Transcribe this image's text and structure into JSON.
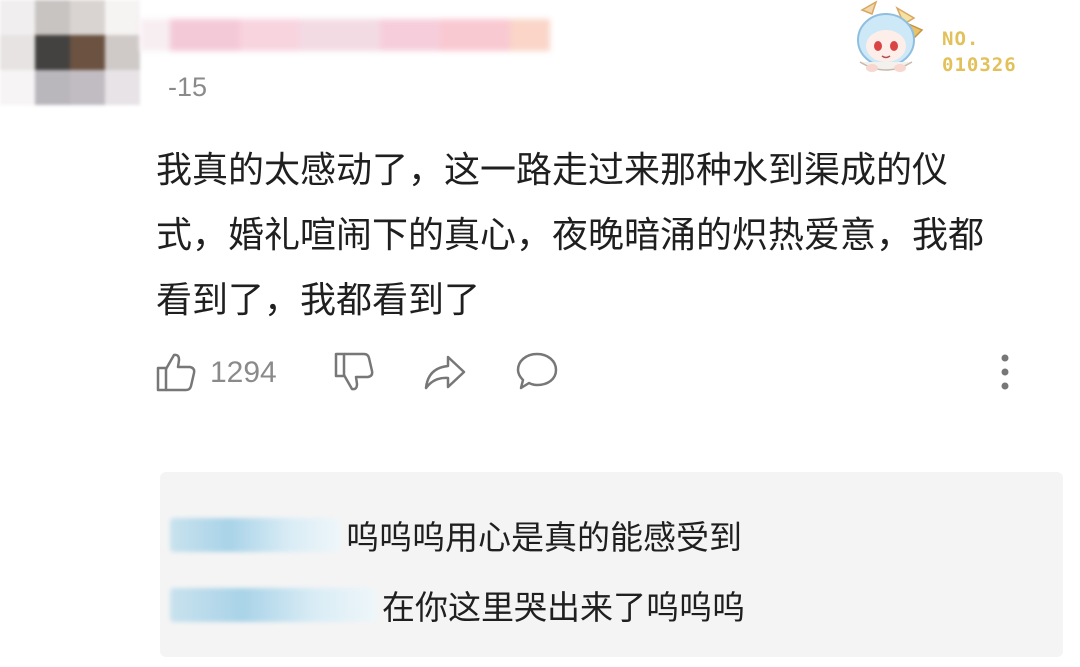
{
  "comment": {
    "date_fragment": "-15",
    "lines": [
      "我真的太感动了，这一路走过来那种水到渠成的仪",
      "式，婚礼喧闹下的真心，夜晚暗涌的炽热爱意，我都",
      "看到了，我都看到了"
    ],
    "like_count": "1294"
  },
  "badge": {
    "label_line1": "NO.",
    "label_line2": "010326"
  },
  "replies": [
    {
      "text": "呜呜呜用心是真的能感受到"
    },
    {
      "text": "在你这里哭出来了呜呜呜"
    }
  ],
  "icons": [
    "thumbs-up-icon",
    "thumbs-down-icon",
    "share-icon",
    "comment-icon",
    "more-vertical-icon"
  ],
  "colors": {
    "badge_gold": "#e2c15a",
    "meta_gray": "#8a8a8a",
    "reply_bg": "#f4f4f4"
  }
}
